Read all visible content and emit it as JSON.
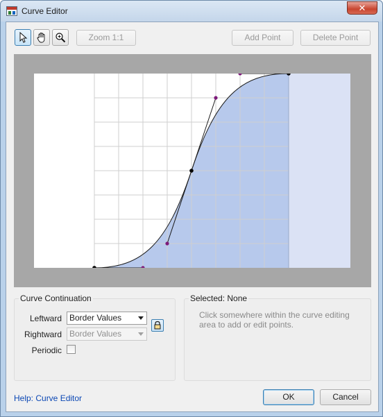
{
  "window": {
    "title": "Curve Editor",
    "close_glyph": "✕"
  },
  "toolbar": {
    "tools": [
      {
        "icon": "arrow-pointer-icon",
        "active": true
      },
      {
        "icon": "hand-pan-icon",
        "active": false
      },
      {
        "icon": "zoom-magnifier-icon",
        "active": false
      }
    ],
    "zoom_label": "Zoom 1:1",
    "add_point_label": "Add Point",
    "delete_point_label": "Delete Point"
  },
  "curve": {
    "colors": {
      "fill": "#b7c9ec",
      "extension": "#dbe2f5",
      "handle": "#7d1a7a",
      "key": "#000000",
      "grid": "#cfcfcf"
    },
    "key_points": [
      [
        0,
        0
      ],
      [
        0.5,
        0.5
      ],
      [
        1,
        1
      ]
    ],
    "handles": [
      [
        0.25,
        0
      ],
      [
        0.375,
        0.125
      ],
      [
        0.625,
        0.875
      ],
      [
        0.75,
        1
      ]
    ]
  },
  "continuation": {
    "title": "Curve Continuation",
    "leftward_label": "Leftward",
    "leftward_value": "Border Values",
    "rightward_label": "Rightward",
    "rightward_value": "Border Values",
    "periodic_label": "Periodic",
    "periodic_checked": false
  },
  "selection": {
    "title": "Selected: None",
    "hint_line1": "Click somewhere within the curve editing",
    "hint_line2": "area to add or edit points."
  },
  "footer": {
    "help_link": "Help: Curve Editor",
    "ok_label": "OK",
    "cancel_label": "Cancel"
  }
}
